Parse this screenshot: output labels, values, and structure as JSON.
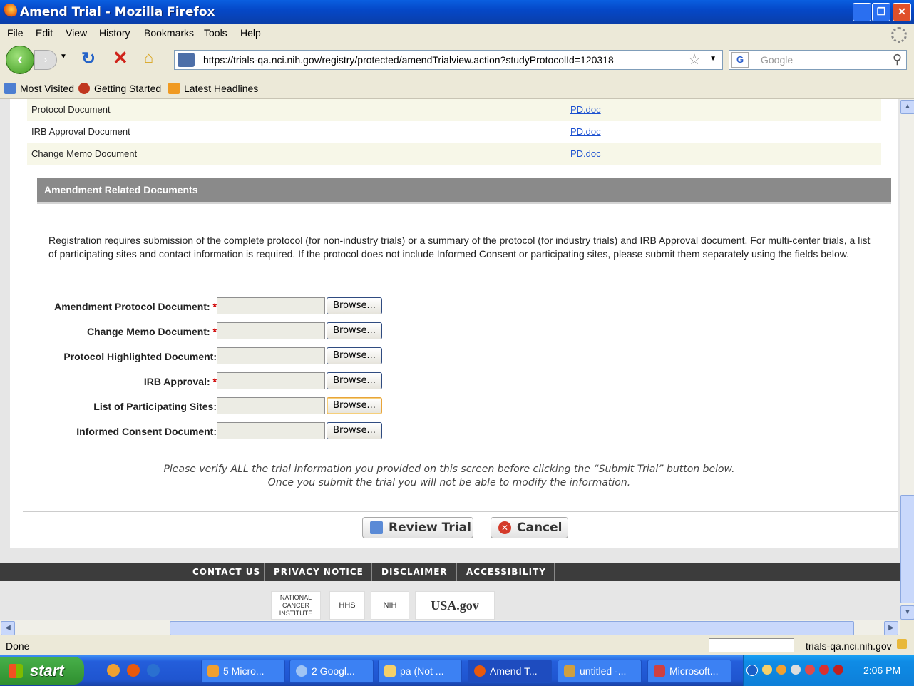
{
  "window": {
    "title": "Amend Trial - Mozilla Firefox",
    "min": "_",
    "max": "❐",
    "close": "✕"
  },
  "menu": [
    "File",
    "Edit",
    "View",
    "History",
    "Bookmarks",
    "Tools",
    "Help"
  ],
  "nav": {
    "url": "https://trials-qa.nci.nih.gov/registry/protected/amendTrialview.action?studyProtocolId=120318",
    "search_placeholder": "Google"
  },
  "bookmarks": [
    "Most Visited",
    "Getting Started",
    "Latest Headlines"
  ],
  "documents": [
    {
      "name": "Protocol Document",
      "file": "PD.doc"
    },
    {
      "name": "IRB Approval Document",
      "file": "PD.doc"
    },
    {
      "name": "Change Memo Document",
      "file": "PD.doc"
    }
  ],
  "section_title": "Amendment Related Documents",
  "intro": "Registration requires submission of the complete protocol (for non-industry trials) or a summary of the protocol (for industry trials) and IRB Approval document. For multi-center trials, a list of participating sites and contact information is required. If the protocol does not include Informed Consent or participating sites, please submit them separately using the fields below.",
  "fields": [
    {
      "label": "Amendment Protocol Document:",
      "required": "*",
      "browse": "Browse..."
    },
    {
      "label": "Change Memo Document:",
      "required": "*",
      "browse": "Browse..."
    },
    {
      "label": "Protocol Highlighted Document:",
      "required": "",
      "browse": "Browse..."
    },
    {
      "label": "IRB Approval:",
      "required": "*",
      "browse": "Browse..."
    },
    {
      "label": "List of Participating Sites:",
      "required": "",
      "browse": "Browse..."
    },
    {
      "label": "Informed Consent Document:",
      "required": "",
      "browse": "Browse..."
    }
  ],
  "verify": {
    "line1": "Please verify ALL the trial information you provided on this screen before clicking the “Submit Trial” button below.",
    "line2": "Once you submit the trial you will not be able to modify the information."
  },
  "buttons": {
    "review": "Review Trial",
    "cancel": "Cancel"
  },
  "footer_links": [
    "CONTACT US",
    "PRIVACY NOTICE",
    "DISCLAIMER",
    "ACCESSIBILITY"
  ],
  "footer_logos": [
    "NATIONAL CANCER INSTITUTE",
    "HHS",
    "NIH",
    "USA.gov"
  ],
  "status": {
    "text": "Done",
    "host": "trials-qa.nci.nih.gov"
  },
  "taskbar": {
    "start": "start",
    "tasks": [
      "5 Micro...",
      "2 Googl...",
      "pa (Not ...",
      "Amend T...",
      "untitled -...",
      "Microsoft..."
    ],
    "clock": "2:06 PM"
  }
}
